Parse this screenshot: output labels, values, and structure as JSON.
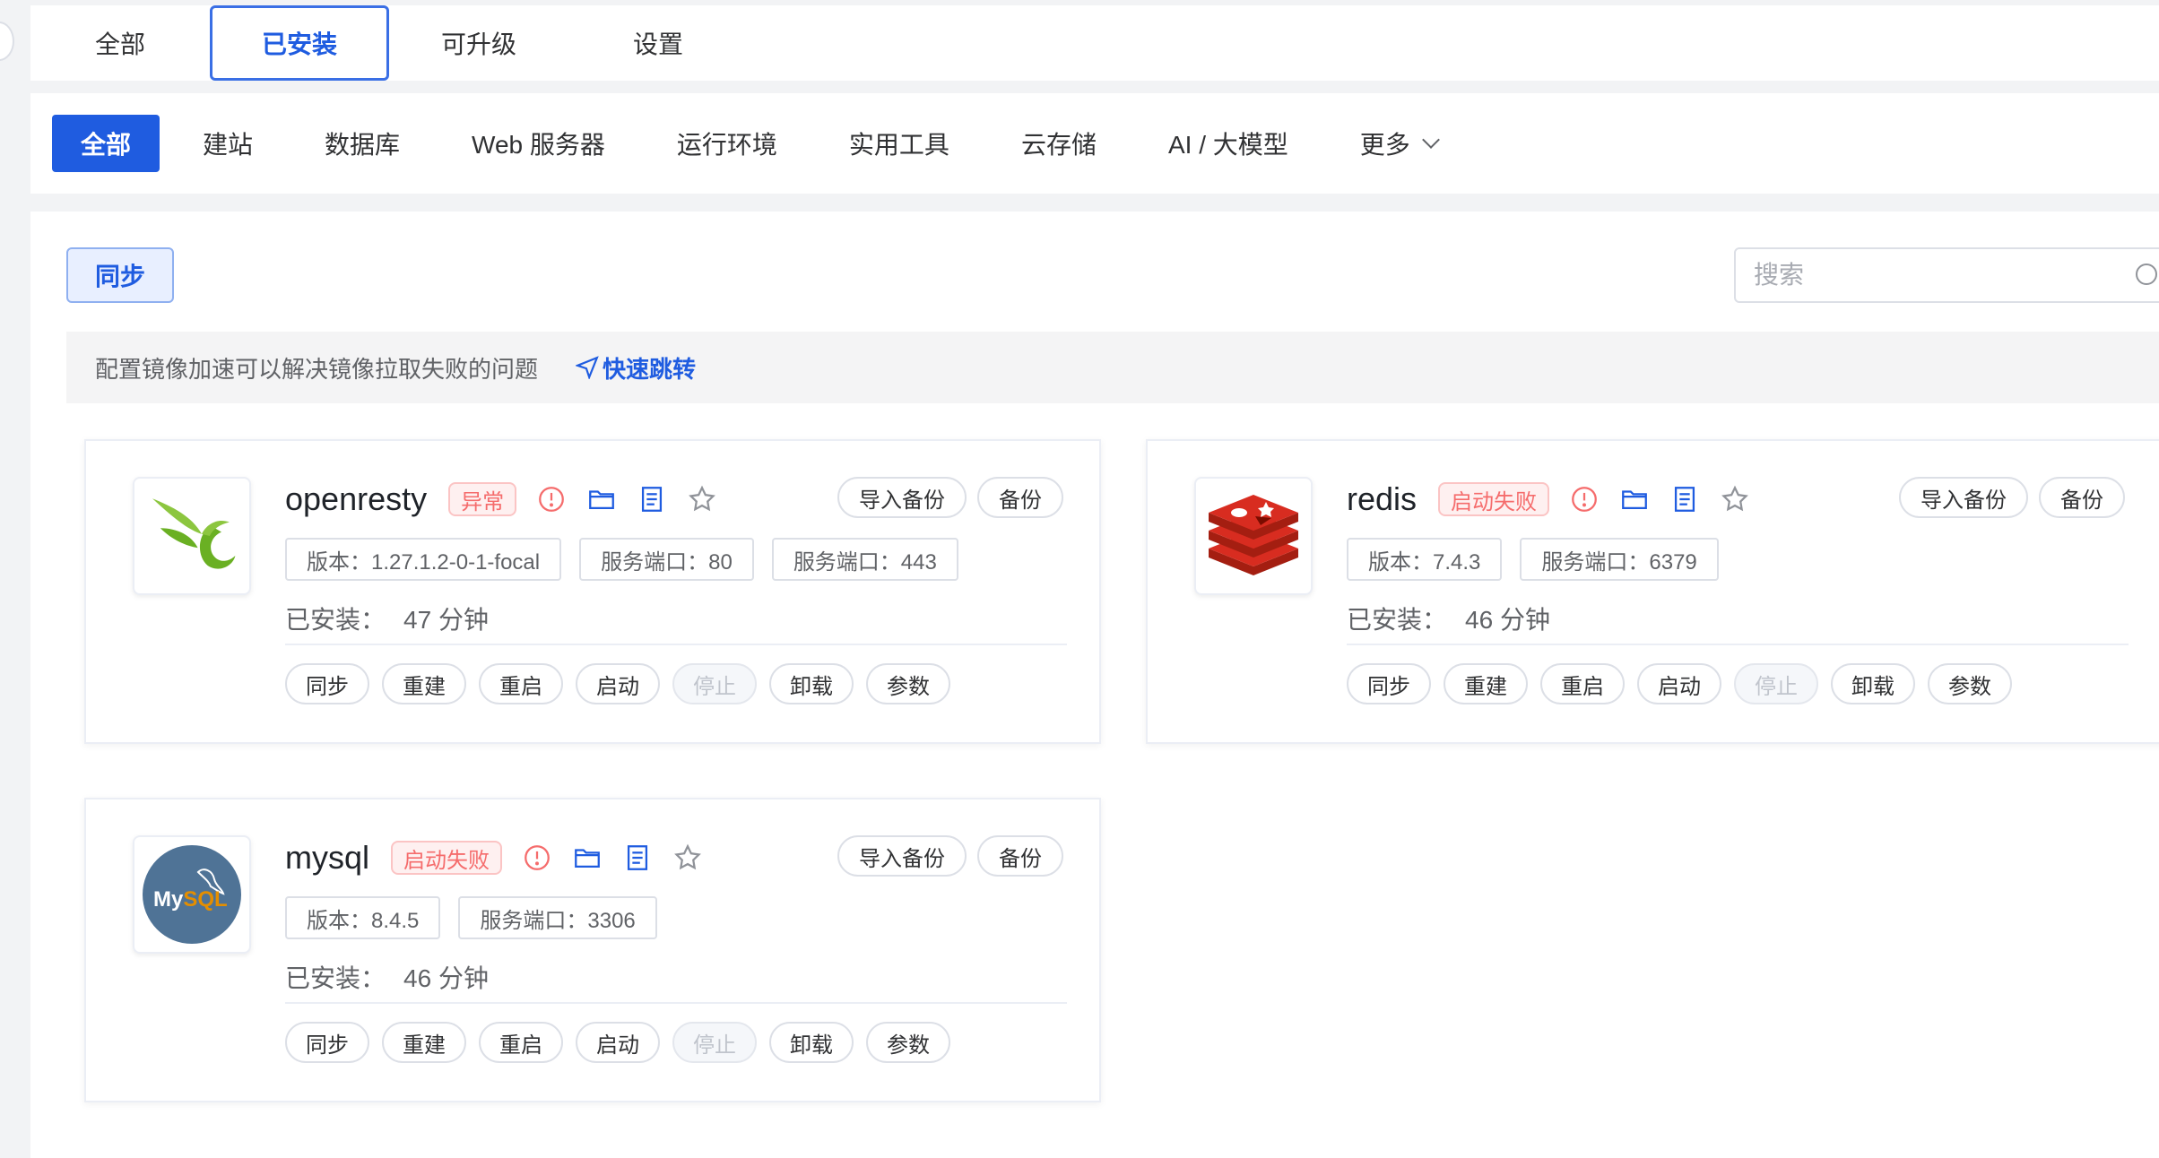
{
  "main_tabs": [
    {
      "label": "全部"
    },
    {
      "label": "已安装"
    },
    {
      "label": "可升级"
    },
    {
      "label": "设置"
    }
  ],
  "main_tab_active": "已安装",
  "categories": [
    {
      "label": "全部"
    },
    {
      "label": "建站"
    },
    {
      "label": "数据库"
    },
    {
      "label": "Web 服务器"
    },
    {
      "label": "运行环境"
    },
    {
      "label": "实用工具"
    },
    {
      "label": "云存储"
    },
    {
      "label": "AI / 大模型"
    },
    {
      "label": "更多"
    }
  ],
  "toolbar": {
    "sync_label": "同步",
    "search_placeholder": "搜索"
  },
  "notice": {
    "text": "配置镜像加速可以解决镜像拉取失败的问题",
    "link": "快速跳转"
  },
  "card_buttons": {
    "import_backup": "导入备份",
    "backup": "备份"
  },
  "installed_label": "已安装：",
  "actions": [
    {
      "label": "同步",
      "disabled": false
    },
    {
      "label": "重建",
      "disabled": false
    },
    {
      "label": "重启",
      "disabled": false
    },
    {
      "label": "启动",
      "disabled": false
    },
    {
      "label": "停止",
      "disabled": true
    },
    {
      "label": "卸载",
      "disabled": false
    },
    {
      "label": "参数",
      "disabled": false
    }
  ],
  "apps": [
    {
      "name": "openresty",
      "status": "异常",
      "tags": [
        "版本：1.27.1.2-0-1-focal",
        "服务端口：80",
        "服务端口：443"
      ],
      "installed": "47 分钟",
      "logo": "openresty-logo"
    },
    {
      "name": "redis",
      "status": "启动失败",
      "tags": [
        "版本：7.4.3",
        "服务端口：6379"
      ],
      "installed": "46 分钟",
      "logo": "redis-logo"
    },
    {
      "name": "mysql",
      "status": "启动失败",
      "tags": [
        "版本：8.4.5",
        "服务端口：3306"
      ],
      "installed": "46 分钟",
      "logo": "mysql-logo",
      "logo_text": "MySQL"
    }
  ],
  "colors": {
    "primary": "#1f5ce0",
    "danger": "#f56c6c",
    "redis": "#c6302b",
    "mysql_bg": "#4f7396",
    "openresty_green": "#6ab023"
  }
}
